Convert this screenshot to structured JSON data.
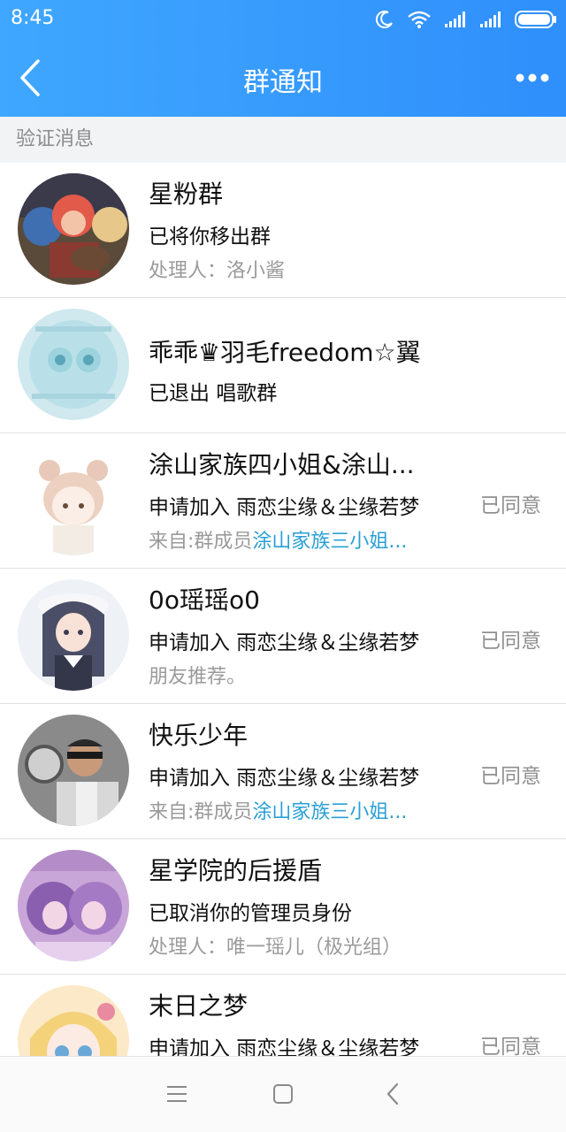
{
  "status_bar": {
    "time": "8:45",
    "icons": [
      "moon-icon",
      "wifi-icon",
      "signal-icon",
      "signal-icon",
      "battery-icon"
    ]
  },
  "header": {
    "title": "群通知",
    "back_icon": "back-arrow-icon",
    "more_icon": "more-icon"
  },
  "section": {
    "label": "验证消息"
  },
  "items": [
    {
      "title": "星粉群",
      "desc": "已将你移出群",
      "sub": "处理人：洛小酱",
      "sub_link": "",
      "status": ""
    },
    {
      "title": "乖乖♛羽毛freedom☆翼",
      "desc": "已退出 唱歌群",
      "sub": "",
      "sub_link": "",
      "status": ""
    },
    {
      "title": "涂山家族四小姐&涂山...",
      "desc": "申请加入 雨恋尘缘＆尘缘若梦",
      "sub": "来自:群成员",
      "sub_link": "涂山家族三小姐...",
      "status": "已同意"
    },
    {
      "title": "0o瑶瑶o0",
      "desc": "申请加入 雨恋尘缘＆尘缘若梦",
      "sub": "朋友推荐。",
      "sub_link": "",
      "status": "已同意"
    },
    {
      "title": "快乐少年",
      "desc": "申请加入 雨恋尘缘＆尘缘若梦",
      "sub": "来自:群成员",
      "sub_link": "涂山家族三小姐...",
      "status": "已同意"
    },
    {
      "title": "星学院的后援盾",
      "desc": "已取消你的管理员身份",
      "sub": "处理人：唯一瑶儿（极光组）",
      "sub_link": "",
      "status": ""
    },
    {
      "title": "末日之梦",
      "desc": "申请加入 雨恋尘缘＆尘缘若梦",
      "sub": "",
      "sub_link": "",
      "status": "已同意"
    }
  ],
  "nav_bar": {
    "icons": [
      "menu-icon",
      "home-icon",
      "back-icon"
    ]
  },
  "colors": {
    "header_gradient_start": "#3fa7ff",
    "header_gradient_end": "#2f8ffb",
    "link": "#2a9fd6",
    "muted": "#9a9a9a"
  }
}
